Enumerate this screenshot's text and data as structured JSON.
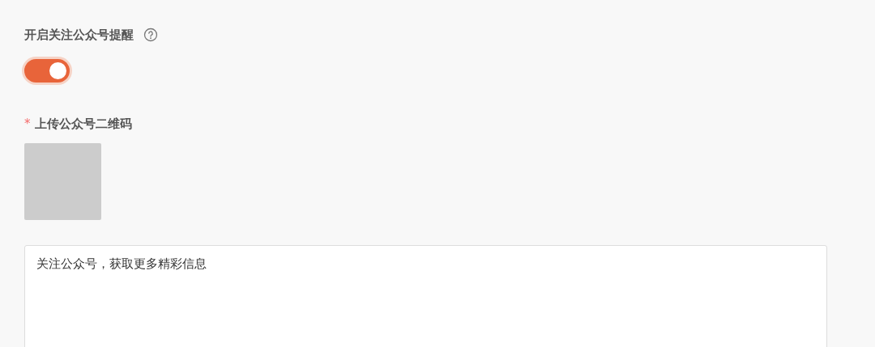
{
  "reminder": {
    "label": "开启关注公众号提醒",
    "on": true
  },
  "qr_upload": {
    "required_mark": "*",
    "label": "上传公众号二维码"
  },
  "message": {
    "value": "关注公众号，获取更多精彩信息"
  }
}
